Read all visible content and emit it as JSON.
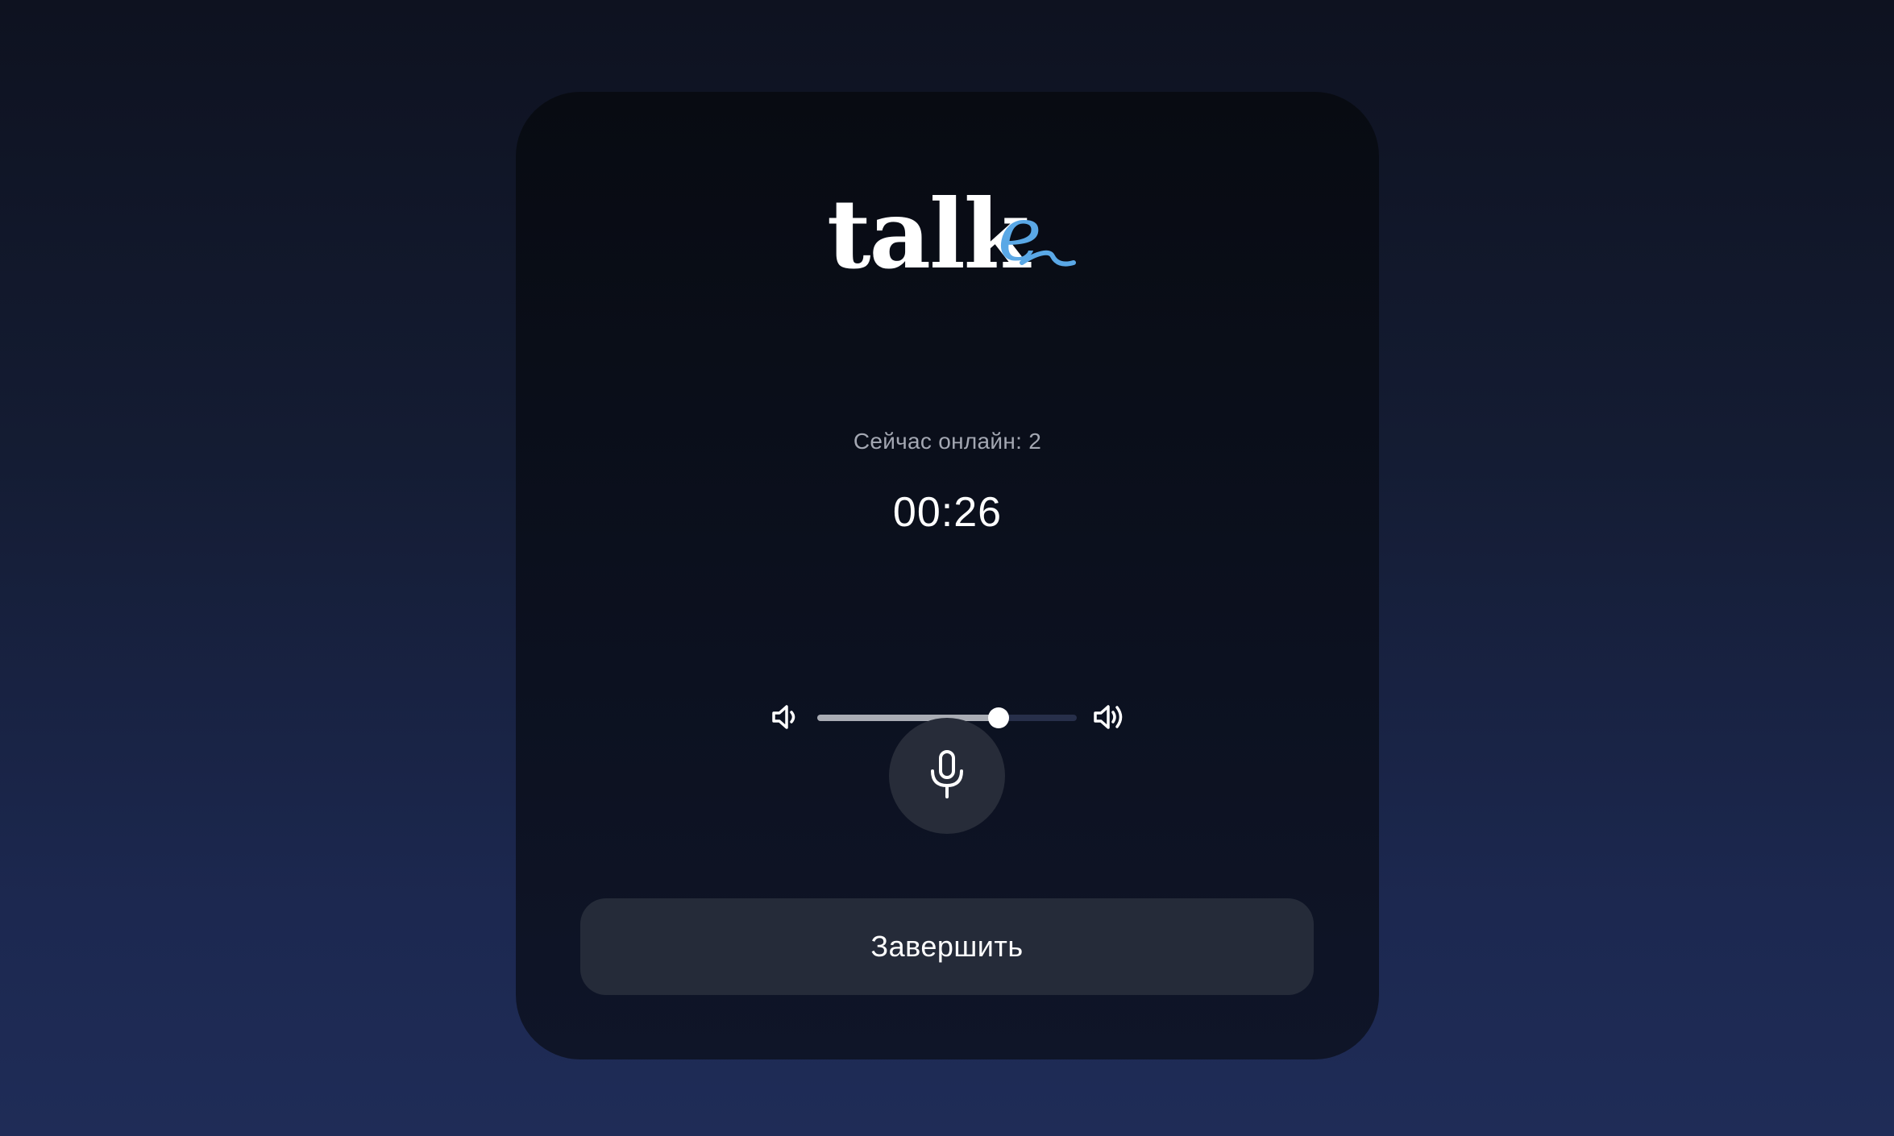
{
  "brand": {
    "logo_text": "talke",
    "logo_main": "talk",
    "logo_accent": "e",
    "accent_color": "#5aa8e6"
  },
  "status": {
    "online_label": "Сейчас онлайн: 2",
    "timer": "00:26"
  },
  "volume": {
    "level": 0.7,
    "low_icon": "volume-low-icon",
    "high_icon": "volume-high-icon"
  },
  "controls": {
    "mic_icon": "microphone-icon",
    "end_label": "Завершить"
  }
}
